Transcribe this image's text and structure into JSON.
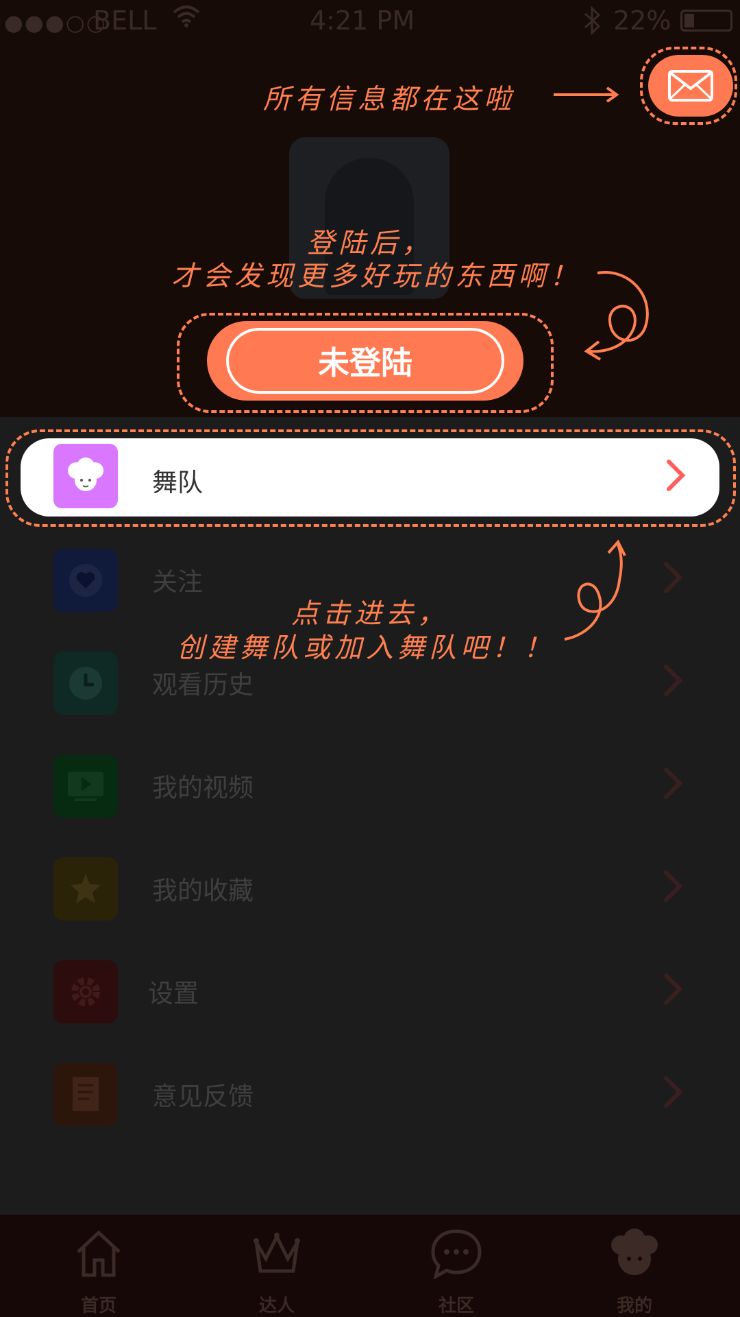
{
  "status_bar": {
    "signal": "●●●○○",
    "carrier": "BELL",
    "time": "4:21 PM",
    "battery": "22%",
    "battery_level": 0.22
  },
  "header": {
    "login_button_label": "未登陆"
  },
  "annotations": {
    "mail_hint": "所有信息都在这啦",
    "login_hint_line1": "登陆后，",
    "login_hint_line2": "才会发现更多好玩的东西啊！",
    "dance_hint_line1": "点击进去，",
    "dance_hint_line2": "创建舞队或加入舞队吧！！"
  },
  "menu": {
    "items": [
      {
        "label": "舞队",
        "icon": "dance-team-icon",
        "color": "#d977ff"
      },
      {
        "label": "关注",
        "icon": "heart-icon",
        "color": "#101a3a"
      },
      {
        "label": "观看历史",
        "icon": "clock-icon",
        "color": "#0f2a24"
      },
      {
        "label": "我的视频",
        "icon": "video-icon",
        "color": "#062b10"
      },
      {
        "label": "我的收藏",
        "icon": "star-icon",
        "color": "#2b2308"
      },
      {
        "label": "设置",
        "icon": "gear-icon",
        "color": "#2c0c0c"
      },
      {
        "label": "意见反馈",
        "icon": "feedback-icon",
        "color": "#2c150b"
      }
    ]
  },
  "tabbar": {
    "tabs": [
      {
        "label": "首页",
        "icon": "home-icon"
      },
      {
        "label": "达人",
        "icon": "crown-icon"
      },
      {
        "label": "社区",
        "icon": "chat-icon"
      },
      {
        "label": "我的",
        "icon": "profile-icon",
        "active": true
      }
    ]
  },
  "colors": {
    "accent": "#ff7a52",
    "overlay_dim": "#1c1c1c"
  }
}
